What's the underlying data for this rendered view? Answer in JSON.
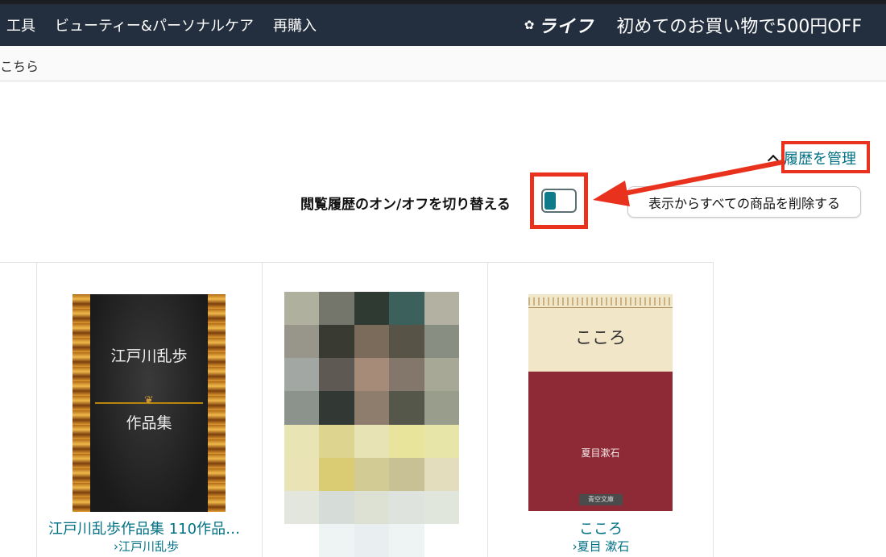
{
  "nav": {
    "links": [
      "工具",
      "ビューティー&パーソナルケア",
      "再購入"
    ],
    "promo_logo": "ライフ",
    "promo_text": "初めてのお買い物で500円OFF"
  },
  "subbar": {
    "text": "こちら"
  },
  "history": {
    "manage_label": "履歴を管理",
    "toggle_label": "閲覧履歴のオン/オフを切り替える",
    "toggle_state": "on",
    "delete_all_label": "表示からすべての商品を削除する"
  },
  "annotation": {
    "highlight_color": "#e8321e"
  },
  "products": [
    {
      "cover_title_line1": "江戸川乱歩",
      "cover_title_line2": "作品集",
      "title": "江戸川乱歩作品集 110作品…",
      "author": "›江戸川乱歩"
    },
    {
      "cover": "pixelated"
    },
    {
      "cover_title": "こころ",
      "cover_author": "夏目漱石",
      "cover_publisher": "青空文庫",
      "title": "こころ",
      "author": "›夏目 漱石"
    }
  ],
  "colors": {
    "nav_bg": "#232f3e",
    "link": "#007185",
    "toggle_on": "#0f7a8a"
  }
}
